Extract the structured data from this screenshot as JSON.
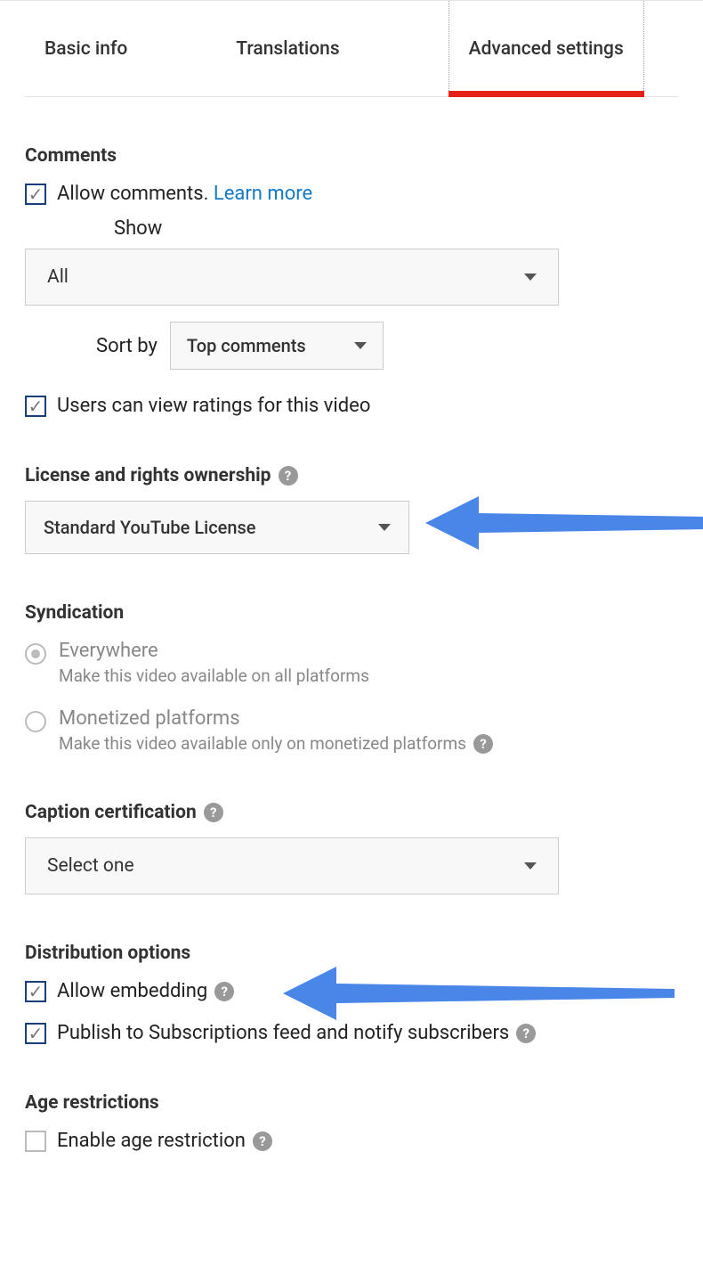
{
  "tabs": {
    "basic": "Basic info",
    "translations": "Translations",
    "advanced": "Advanced settings"
  },
  "comments": {
    "heading": "Comments",
    "allow_label": "Allow comments. ",
    "learn_more": "Learn more",
    "show_label": "Show",
    "show_value": "All",
    "sort_label": "Sort by",
    "sort_value": "Top comments",
    "ratings_label": "Users can view ratings for this video"
  },
  "license": {
    "heading": "License and rights ownership",
    "value": "Standard YouTube License"
  },
  "syndication": {
    "heading": "Syndication",
    "everywhere_label": "Everywhere",
    "everywhere_desc": "Make this video available on all platforms",
    "monetized_label": "Monetized platforms",
    "monetized_desc": "Make this video available only on monetized platforms"
  },
  "caption": {
    "heading": "Caption certification",
    "value": "Select one"
  },
  "distribution": {
    "heading": "Distribution options",
    "embed_label": "Allow embedding",
    "publish_label": "Publish to Subscriptions feed and notify subscribers"
  },
  "age": {
    "heading": "Age restrictions",
    "enable_label": "Enable age restriction"
  },
  "glyphs": {
    "help": "?"
  }
}
